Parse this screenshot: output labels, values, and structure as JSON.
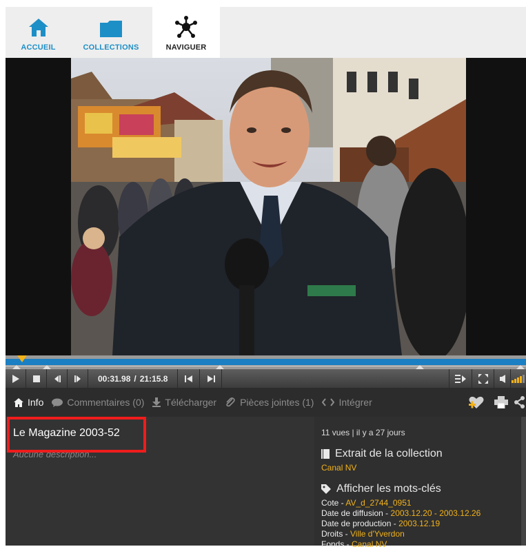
{
  "nav": {
    "tabs": [
      {
        "label": "ACCUEIL",
        "icon": "home-icon"
      },
      {
        "label": "COLLECTIONS",
        "icon": "folder-icon"
      },
      {
        "label": "NAVIGUER",
        "icon": "network-icon"
      }
    ],
    "active_tab": "NAVIGUER",
    "accent_color": "#1d8fc7"
  },
  "player": {
    "current_time": "00:31.98",
    "separator": "/",
    "total_time": "21:15.8",
    "progress_fraction": 0.025,
    "volume_level_fraction": 0.8
  },
  "tabs": {
    "info": "Info",
    "comments": "Commentaires (0)",
    "download": "Télécharger",
    "attachments": "Pièces jointes (1)",
    "embed": "Intégrer"
  },
  "media": {
    "title": "Le Magazine 2003-52",
    "description": "Aucune description..."
  },
  "sidebar": {
    "views": "11 vues | il y a 27 jours",
    "collection_heading": "Extrait de la collection",
    "collection_name": "Canal NV",
    "keywords_heading": "Afficher les mots-clés",
    "meta": [
      {
        "label": "Cote - ",
        "value": "AV_d_2744_0951"
      },
      {
        "label": "Date de diffusion - ",
        "value": "2003.12.20 - 2003.12.26"
      },
      {
        "label": "Date de production - ",
        "value": "2003.12.19"
      },
      {
        "label": "Droits - ",
        "value": "Ville d'Yverdon"
      },
      {
        "label": "Fonds - ",
        "value": "Canal NV"
      }
    ],
    "highlight_color": "#f2b21a"
  },
  "annotation_color": "#ef1c1c"
}
